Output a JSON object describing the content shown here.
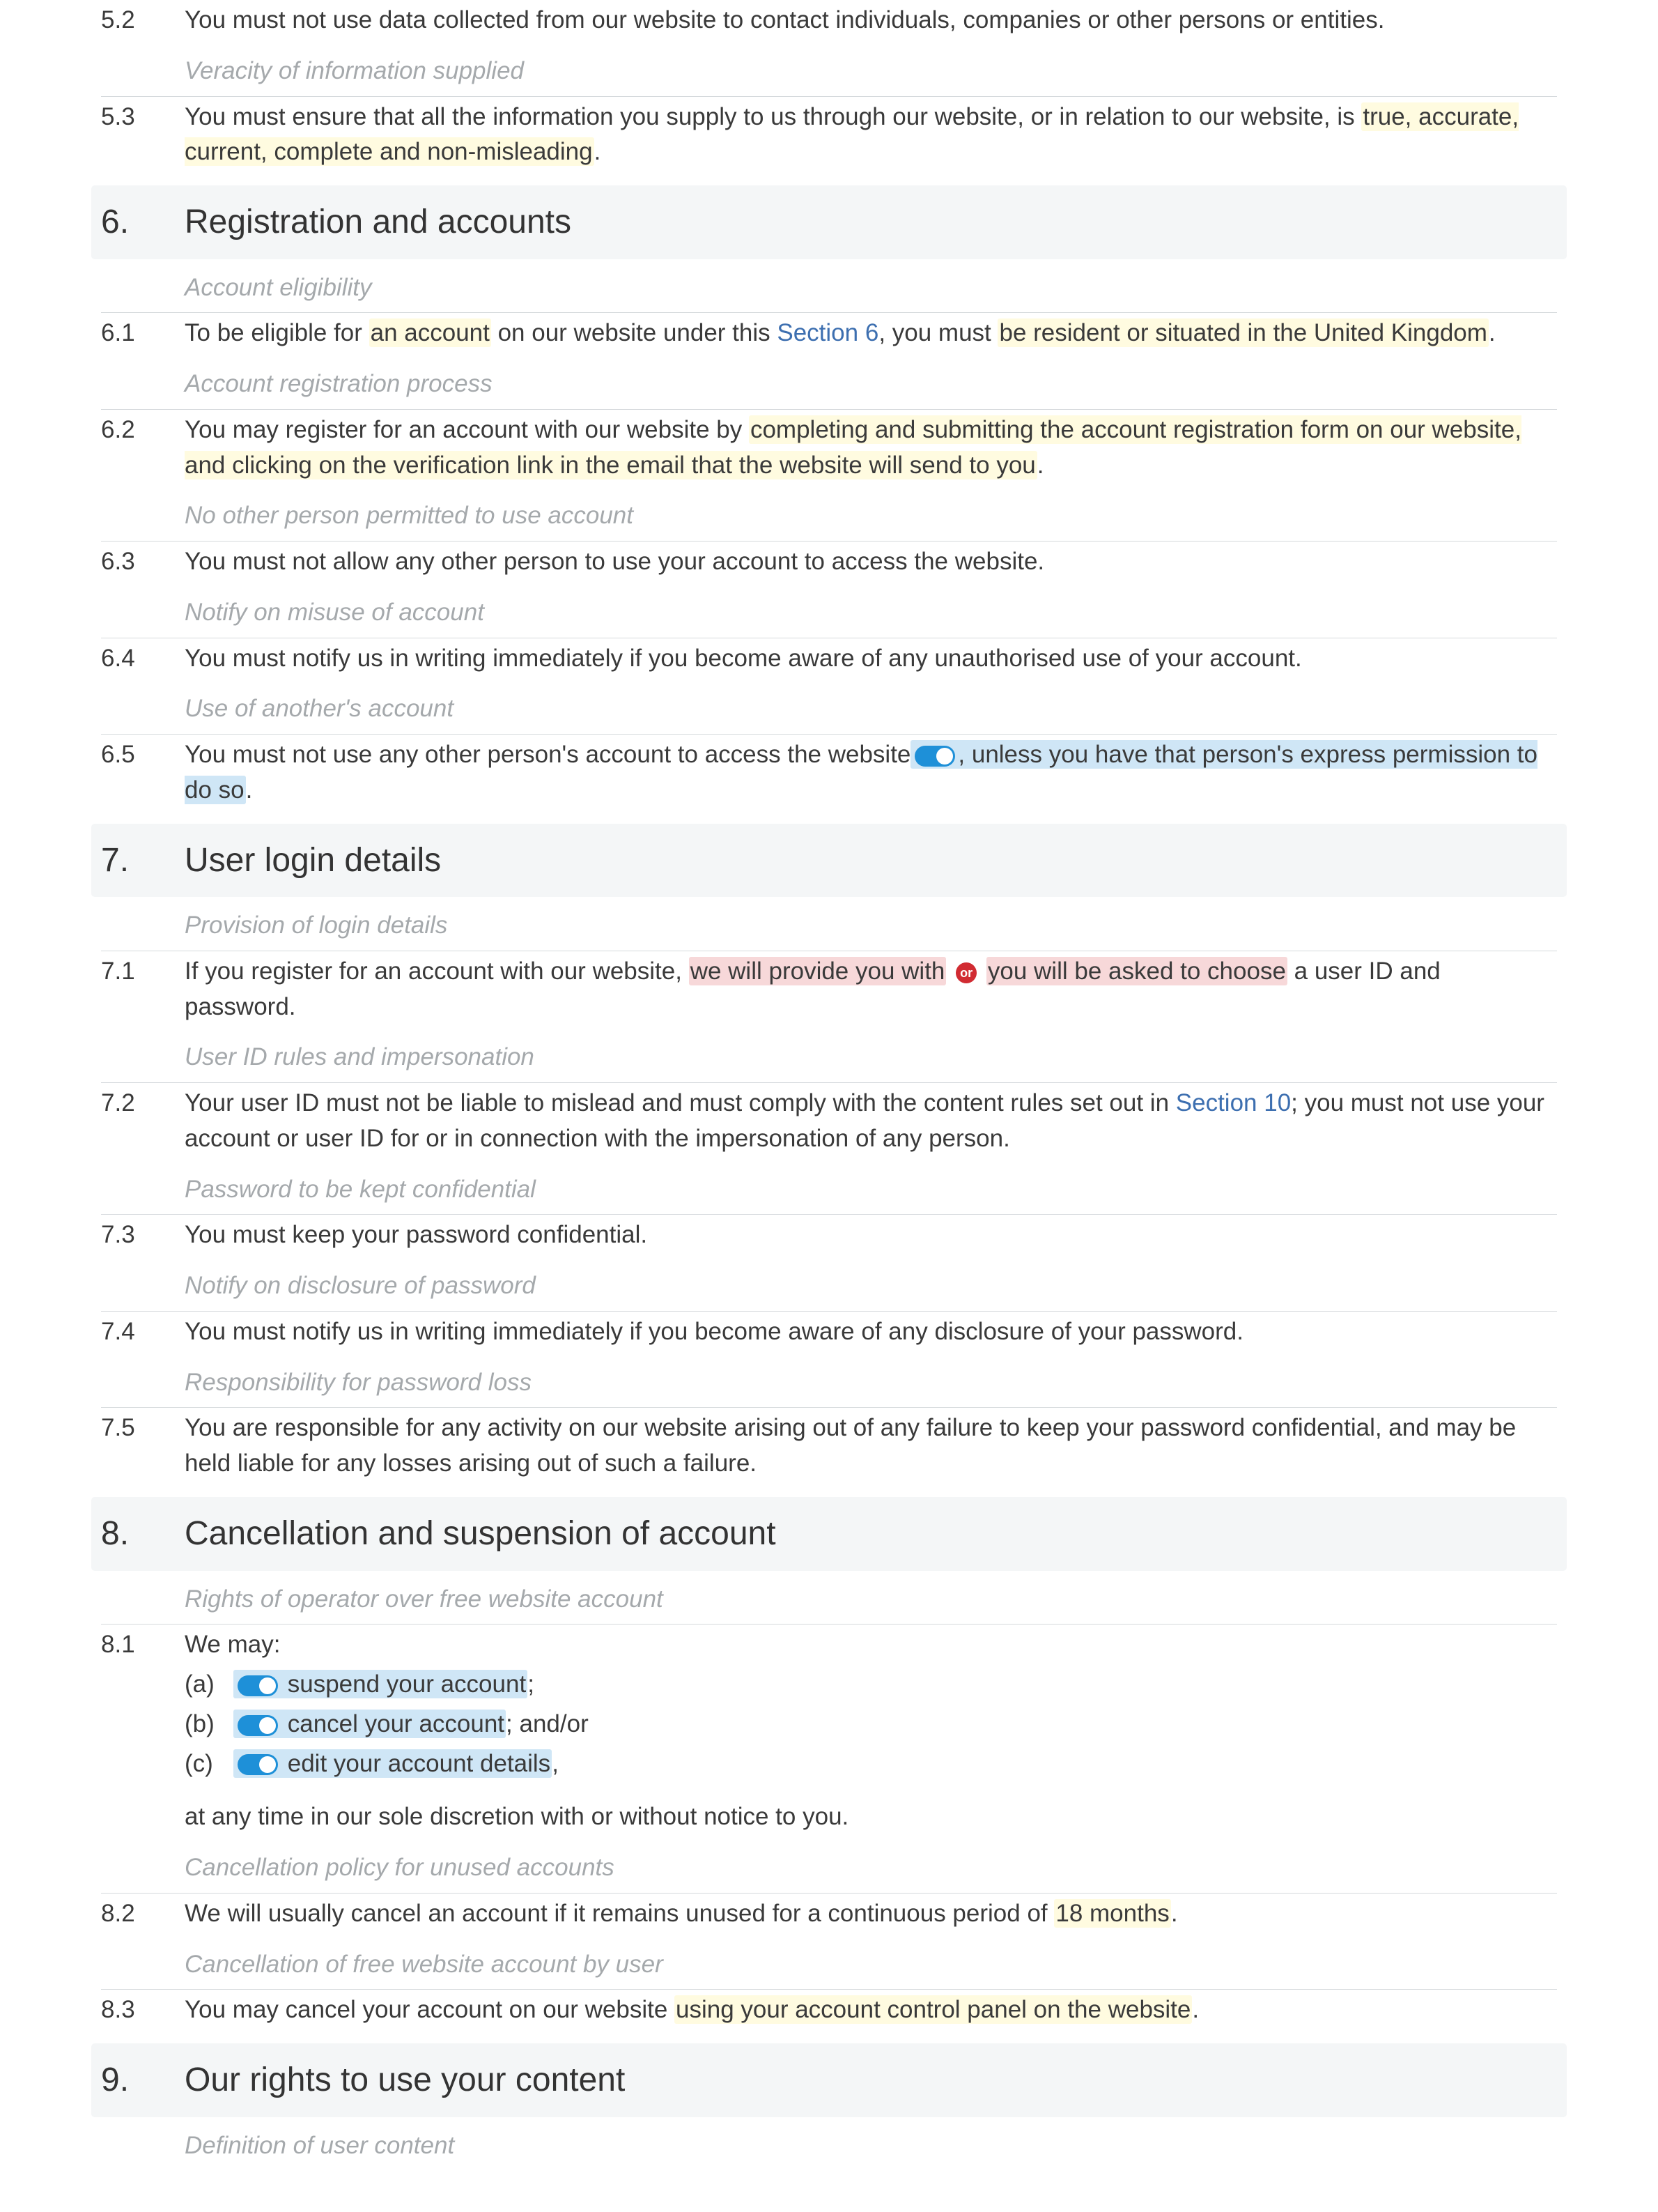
{
  "c52": {
    "num": "5.2",
    "text": "You must not use data collected from our website to contact individuals, companies or other persons or entities."
  },
  "n52": {
    "text": "Veracity of information supplied"
  },
  "c53": {
    "num": "5.3",
    "pre": "You must ensure that all the information you supply to us through our website, or in relation to our website, is ",
    "hl": "true, accurate, current, complete and non-misleading",
    "post": "."
  },
  "s6": {
    "num": "6.",
    "title": "Registration and accounts"
  },
  "n60": {
    "text": "Account eligibility"
  },
  "c61": {
    "num": "6.1",
    "a": "To be eligible for ",
    "h1": "an account",
    "b": " on our website under this ",
    "xref": "Section 6",
    "c": ", you must ",
    "h2": "be resident or situated in the United Kingdom",
    "d": "."
  },
  "n61": {
    "text": "Account registration process"
  },
  "c62": {
    "num": "6.2",
    "a": "You may register for an account with our website by ",
    "h1": "completing and submitting the account registration form on our website, and clicking on the verification link in the email that the website will send to you",
    "b": "."
  },
  "n62": {
    "text": "No other person permitted to use account"
  },
  "c63": {
    "num": "6.3",
    "text": "You must not allow any other person to use your account to access the website."
  },
  "n63": {
    "text": "Notify on misuse of account"
  },
  "c64": {
    "num": "6.4",
    "text": "You must notify us in writing immediately if you become aware of any unauthorised use of your account."
  },
  "n64": {
    "text": "Use of another's account"
  },
  "c65": {
    "num": "6.5",
    "a": "You must not use any other person's account to access the website",
    "h1": ", unless you have that person's express permission to do so",
    "b": "."
  },
  "s7": {
    "num": "7.",
    "title": "User login details"
  },
  "n70": {
    "text": "Provision of login details"
  },
  "c71": {
    "num": "7.1",
    "a": "If you register for an account with our website, ",
    "p1": "we will provide you with",
    "or": "or",
    "p2": "you will be asked to choose",
    "b": " a user ID and password."
  },
  "n71": {
    "text": "User ID rules and impersonation"
  },
  "c72": {
    "num": "7.2",
    "a": "Your user ID must not be liable to mislead and must comply with the content rules set out in ",
    "xref": "Section 10",
    "b": "; you must not use your account or user ID for or in connection with the impersonation of any person."
  },
  "n72": {
    "text": "Password to be kept confidential"
  },
  "c73": {
    "num": "7.3",
    "text": "You must keep your password confidential."
  },
  "n73": {
    "text": "Notify on disclosure of password"
  },
  "c74": {
    "num": "7.4",
    "text": "You must notify us in writing immediately if you become aware of any disclosure of your password."
  },
  "n74": {
    "text": "Responsibility for password loss"
  },
  "c75": {
    "num": "7.5",
    "text": "You are responsible for any activity on our website arising out of any failure to keep your password confidential, and may be held liable for any losses arising out of such a failure."
  },
  "s8": {
    "num": "8.",
    "title": "Cancellation and suspension of account"
  },
  "n80": {
    "text": "Rights of operator over free website account"
  },
  "c81": {
    "num": "8.1",
    "intro": "We may:",
    "a": {
      "p": "(a)",
      "h": "suspend your account",
      "t": ";"
    },
    "b": {
      "p": "(b)",
      "h": "cancel your account",
      "t": "; and/or"
    },
    "c": {
      "p": "(c)",
      "h": "edit your account details",
      "t": ","
    },
    "tail": "at any time in our sole discretion with or without notice to you."
  },
  "n81": {
    "text": "Cancellation policy for unused accounts"
  },
  "c82": {
    "num": "8.2",
    "a": "We will usually cancel an account if it remains unused for a continuous period of ",
    "h1": "18 months",
    "b": "."
  },
  "n82": {
    "text": "Cancellation of free website account by user"
  },
  "c83": {
    "num": "8.3",
    "a": "You may cancel your account on our website ",
    "h1": "using your account control panel on the website",
    "b": "."
  },
  "s9": {
    "num": "9.",
    "title": "Our rights to use your content"
  },
  "n90": {
    "text": "Definition of user content"
  }
}
